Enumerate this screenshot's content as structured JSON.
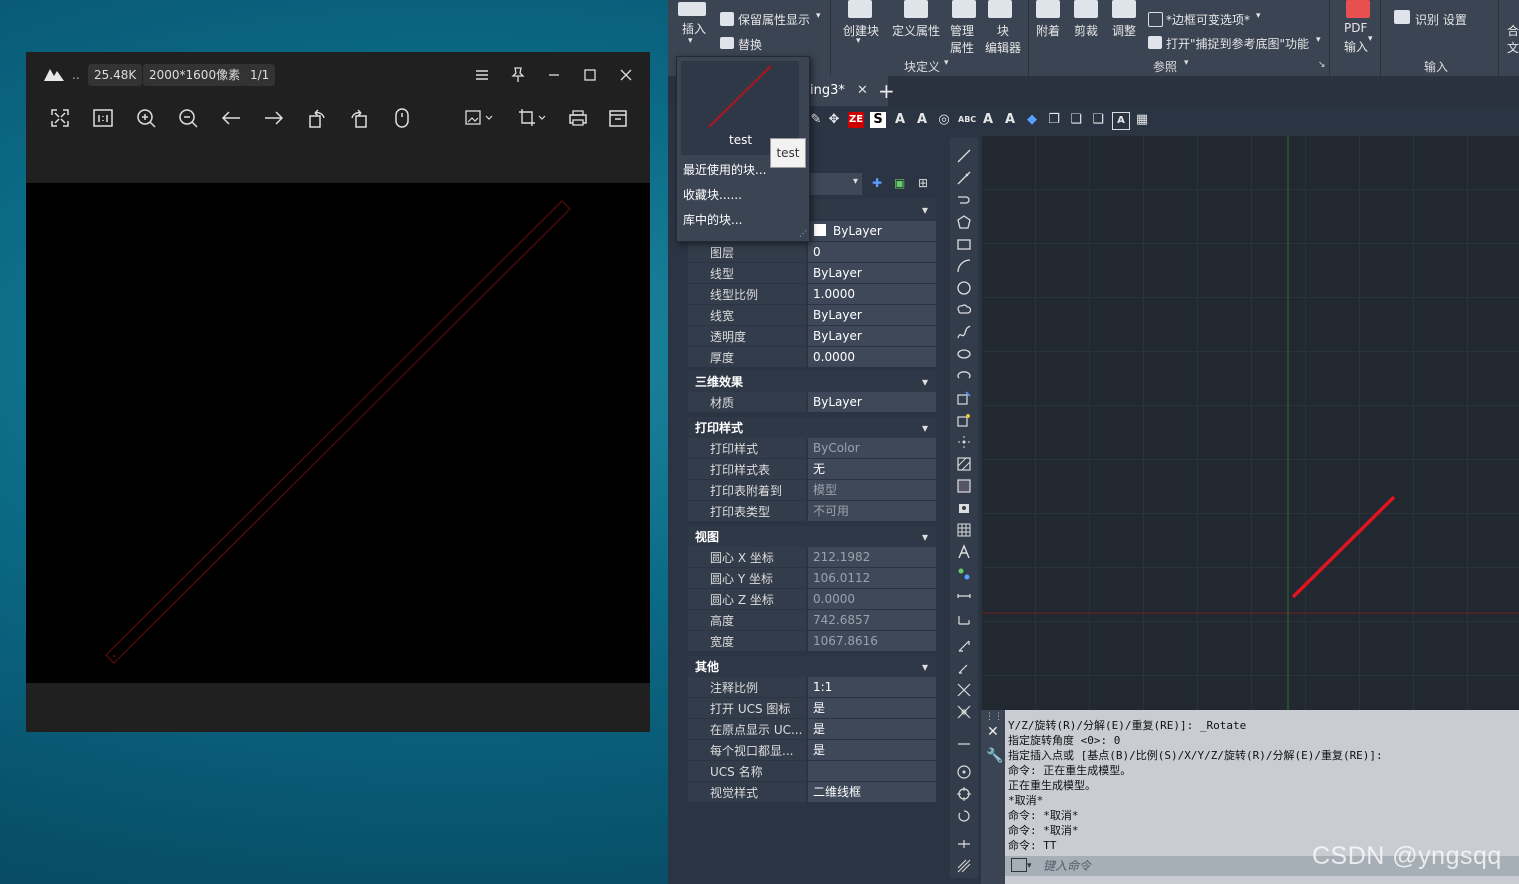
{
  "viewer": {
    "more": "..",
    "file_size": "25.48K",
    "dimensions": "2000*1600像素",
    "page": "1/1",
    "icons": [
      "fullscreen-icon",
      "actual-size-icon",
      "zoom-in-icon",
      "zoom-out-icon",
      "prev-icon",
      "next-icon",
      "rotate-left-icon",
      "rotate-right-icon",
      "mouse-icon",
      "edit-image-icon",
      "crop-icon",
      "print-icon",
      "save-icon"
    ]
  },
  "cad": {
    "ribbon": {
      "insert": "插入",
      "keep_attr": "保留属性显示",
      "replace": "替换",
      "create_block": "创建块",
      "define_attr": "定义属性",
      "manage_attr_1": "管理",
      "manage_attr_2": "属性",
      "block_editor_1": "块",
      "block_editor_2": "编辑器",
      "attach": "附着",
      "clip": "剪裁",
      "adjust": "调整",
      "frame_var": "*边框可变选项*",
      "snap_ref": "打开\"捕捉到参考底图\"功能",
      "pdf_1": "PDF",
      "pdf_2": "输入",
      "recognize": "识别 设置",
      "panel_block_def": "块定义",
      "panel_reference": "参照",
      "panel_import": "输入",
      "cut_1": "合",
      "cut_2": "文"
    },
    "tab_name": "ing3*",
    "dropdown": {
      "thumb_label": "test",
      "tooltip": "test",
      "items": [
        "最近使用的块...",
        "收藏块......",
        "库中的块..."
      ]
    },
    "properties": {
      "color_value": "ByLayer",
      "rows_general": [
        {
          "k": "图层",
          "v": "0"
        },
        {
          "k": "线型",
          "v": "ByLayer"
        },
        {
          "k": "线型比例",
          "v": "1.0000"
        },
        {
          "k": "线宽",
          "v": "ByLayer"
        },
        {
          "k": "透明度",
          "v": "ByLayer"
        },
        {
          "k": "厚度",
          "v": "0.0000"
        }
      ],
      "sec_3d": "三维效果",
      "rows_3d": [
        {
          "k": "材质",
          "v": "ByLayer"
        }
      ],
      "sec_print": "打印样式",
      "rows_print": [
        {
          "k": "打印样式",
          "v": "ByColor"
        },
        {
          "k": "打印样式表",
          "v": "无"
        },
        {
          "k": "打印表附着到",
          "v": "模型"
        },
        {
          "k": "打印表类型",
          "v": "不可用"
        }
      ],
      "sec_view": "视图",
      "rows_view": [
        {
          "k": "圆心 X 坐标",
          "v": "212.1982"
        },
        {
          "k": "圆心 Y 坐标",
          "v": "106.0112"
        },
        {
          "k": "圆心 Z 坐标",
          "v": "0.0000"
        },
        {
          "k": "高度",
          "v": "742.6857"
        },
        {
          "k": "宽度",
          "v": "1067.8616"
        }
      ],
      "sec_other": "其他",
      "rows_other": [
        {
          "k": "注释比例",
          "v": "1:1"
        },
        {
          "k": "打开 UCS 图标",
          "v": "是"
        },
        {
          "k": "在原点显示 UC...",
          "v": "是"
        },
        {
          "k": "每个视口都显...",
          "v": "是"
        },
        {
          "k": "UCS 名称",
          "v": ""
        },
        {
          "k": "视觉样式",
          "v": "二维线框"
        }
      ]
    },
    "command": {
      "lines": [
        "Y/Z/旋转(R)/分解(E)/重复(RE)]: _Rotate",
        "指定旋转角度 <0>: 0",
        "指定插入点或 [基点(B)/比例(S)/X/Y/Z/旋转(R)/分解(E)/重复(RE)]:",
        "命令: 正在重生成模型。",
        "正在重生成模型。",
        "*取消*",
        "命令: *取消*",
        "命令: *取消*",
        "命令: TT"
      ],
      "placeholder": "键入命令"
    }
  },
  "watermark": "CSDN @yngsqq",
  "colors": {
    "red_line": "#e0141e",
    "dark_red": "#5a0a0a",
    "accent_green": "#2e6b2e"
  }
}
